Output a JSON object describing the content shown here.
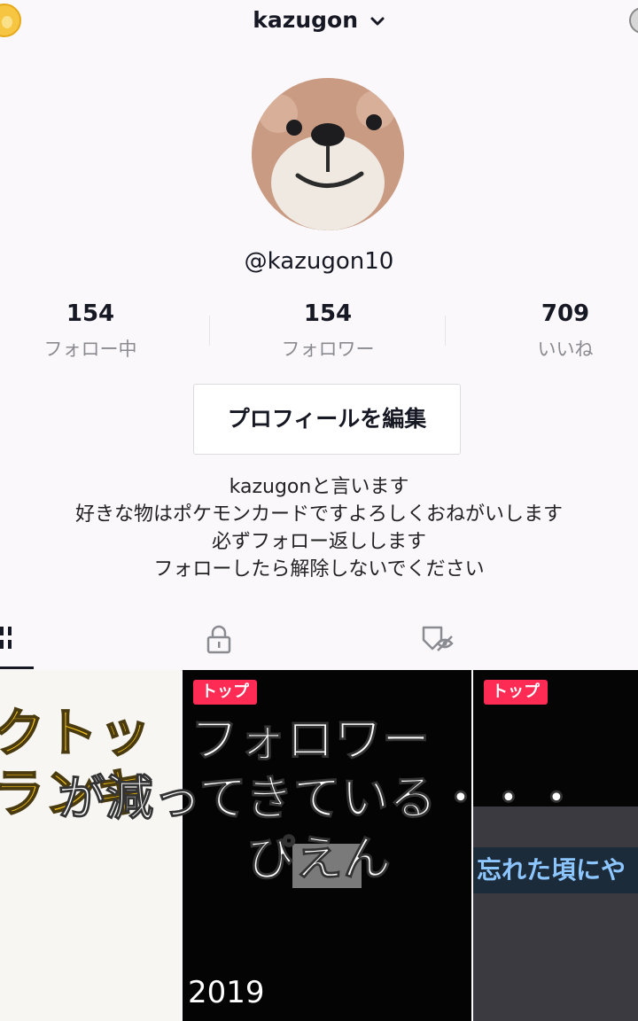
{
  "header": {
    "username": "kazugon"
  },
  "profile": {
    "handle": "@kazugon10",
    "edit_button": "プロフィールを編集"
  },
  "stats": [
    {
      "value": "154",
      "label": "フォロー中"
    },
    {
      "value": "154",
      "label": "フォロワー"
    },
    {
      "value": "709",
      "label": "いいね"
    }
  ],
  "bio": [
    "kazugonと言います",
    "好きな物はポケモンカードですよろしくおねがいします",
    "必ずフォロー返しします",
    "フォローしたら解除しないでください"
  ],
  "tabs": [
    "videos-grid",
    "private",
    "liked"
  ],
  "videos": [
    {
      "text_line1": "クトッ",
      "text_line2": "ランキ"
    },
    {
      "badge": "トップ",
      "year": "2019"
    },
    {
      "badge": "トップ",
      "caption": "忘れた頃にや"
    }
  ],
  "overlay_caption": [
    "フォロワー",
    "が減ってきている・・・",
    "ぴえん"
  ],
  "colors": {
    "accent": "#fe2c55",
    "text": "#161823",
    "muted": "#8a8b91"
  }
}
